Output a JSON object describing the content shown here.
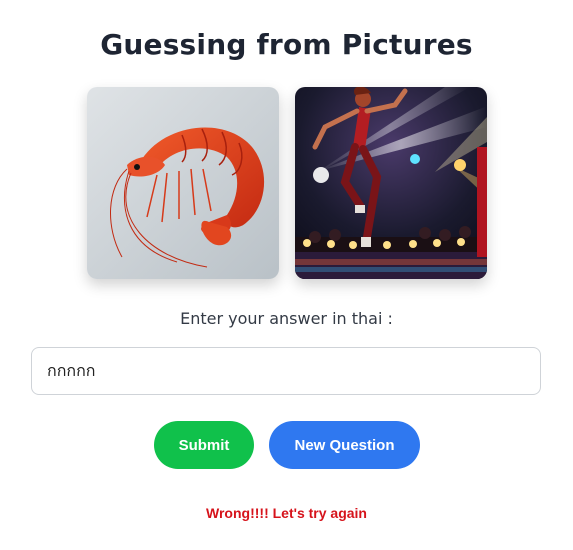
{
  "page": {
    "title": "Guessing from Pictures"
  },
  "images": [
    {
      "name": "shrimp",
      "icon": "shrimp-picture"
    },
    {
      "name": "dancer",
      "icon": "dancer-picture"
    }
  ],
  "prompt": "Enter your answer in thai :",
  "answer_input": {
    "value": "กกกกก",
    "placeholder": ""
  },
  "buttons": {
    "submit_label": "Submit",
    "new_question_label": "New Question"
  },
  "feedback": {
    "text": "Wrong!!!! Let's try again"
  },
  "colors": {
    "title": "#1e2533",
    "submit": "#10c14b",
    "new_question": "#2f78f0",
    "feedback": "#d6131b"
  }
}
